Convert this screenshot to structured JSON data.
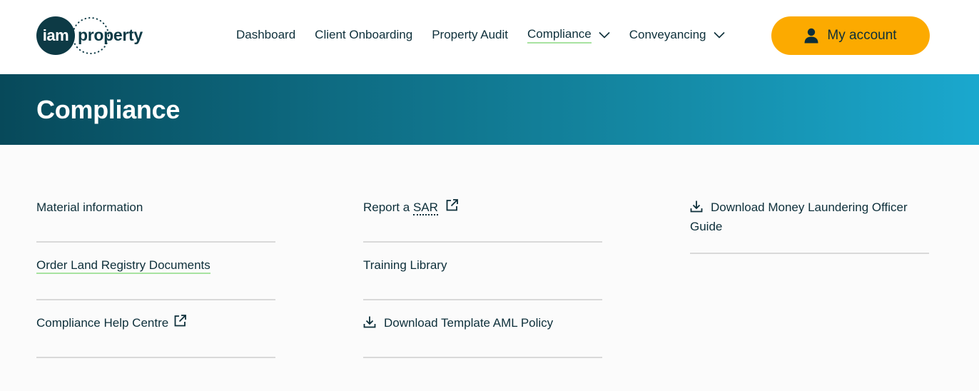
{
  "logo": {
    "disc_text": "iam",
    "word": "property"
  },
  "nav": {
    "items": [
      {
        "label": "Dashboard"
      },
      {
        "label": "Client Onboarding"
      },
      {
        "label": "Property Audit"
      },
      {
        "label": "Compliance",
        "active": true,
        "dropdown": true
      },
      {
        "label": "Conveyancing",
        "dropdown": true
      }
    ],
    "account_label": "My account"
  },
  "banner": {
    "title": "Compliance"
  },
  "links": {
    "col1": [
      {
        "label": "Material information"
      },
      {
        "label": "Order Land Registry Documents",
        "active": true
      },
      {
        "label": "Compliance Help Centre",
        "icon": "external-link-icon"
      }
    ],
    "col2": [
      {
        "label_prefix": "Report a",
        "label_abbr": "SAR",
        "icon": "external-link-icon"
      },
      {
        "label": "Training Library"
      },
      {
        "label": "Download Template AML Policy",
        "icon": "download-icon"
      }
    ],
    "col3": [
      {
        "label": "Download Money Laundering Officer Guide",
        "icon": "download-icon"
      }
    ]
  },
  "colors": {
    "brand_dark": "#0d3a45",
    "accent": "#fcaa00",
    "active_underline": "#a8e3a1",
    "banner_start": "#07495a",
    "banner_end": "#1aa8ce"
  }
}
